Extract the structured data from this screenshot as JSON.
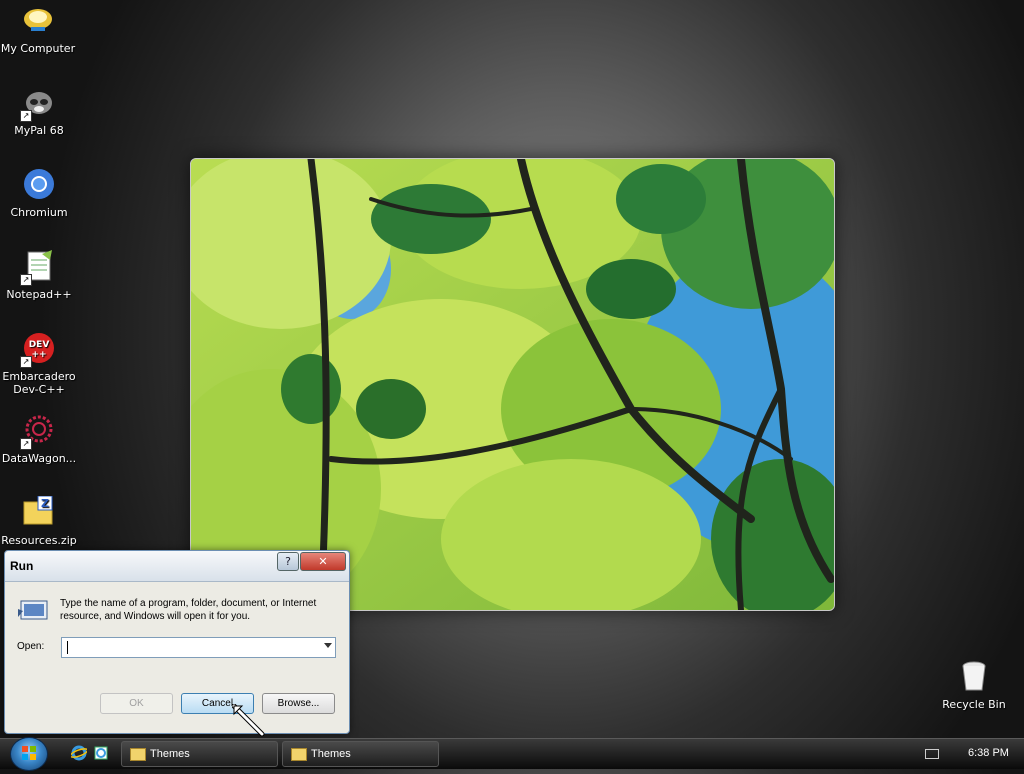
{
  "desktop": {
    "icons": [
      {
        "label": "My Computer"
      },
      {
        "label": "MyPal 68"
      },
      {
        "label": "Chromium"
      },
      {
        "label": "Notepad++"
      },
      {
        "label_line1": "Embarcadero",
        "label_line2": "Dev-C++"
      },
      {
        "label": "DataWagon..."
      },
      {
        "label": "Resources.zip"
      },
      {
        "label": "Recycle Bin"
      }
    ]
  },
  "run_dialog": {
    "title": "Run",
    "help_button": "?",
    "close_button": "✕",
    "description": "Type the name of a program, folder, document, or Internet resource, and Windows will open it for you.",
    "open_label": "Open:",
    "open_value": "",
    "ok_label": "OK",
    "cancel_label": "Cancel",
    "browse_label": "Browse..."
  },
  "taskbar": {
    "tasks": [
      {
        "label": "Themes"
      },
      {
        "label": "Themes"
      }
    ],
    "clock": "6:38 PM"
  },
  "colors": {
    "accent": "#3c7fb1",
    "leaf_light": "#b8dd4f",
    "leaf_dark": "#2f7d34"
  }
}
